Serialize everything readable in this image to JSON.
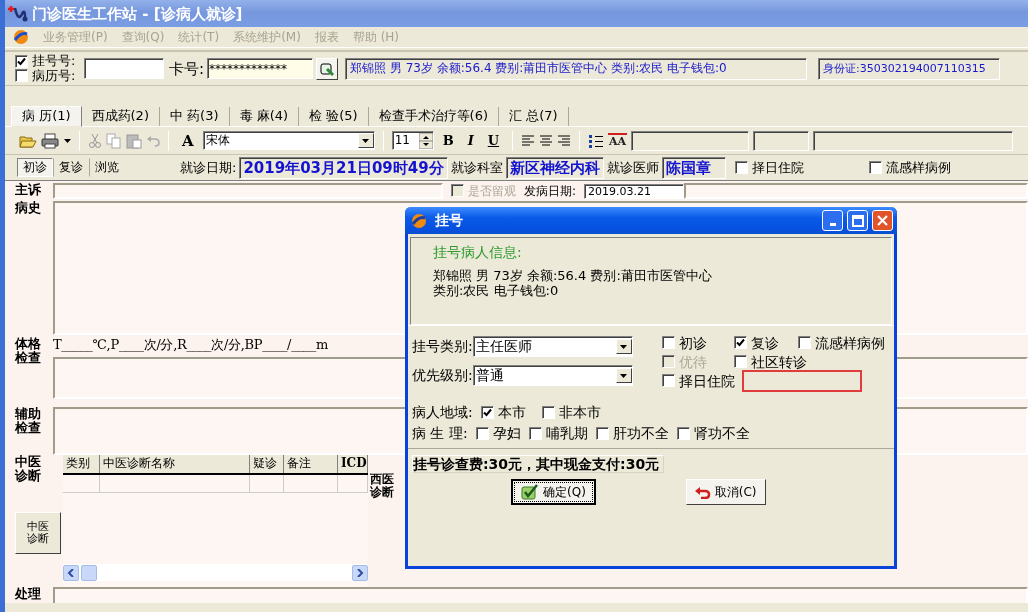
{
  "window": {
    "title": "门诊医生工作站 - [诊病人就诊]"
  },
  "menu": [
    {
      "label": "业务管理(P)",
      "disabled": true
    },
    {
      "label": "查询(Q)",
      "disabled": true
    },
    {
      "label": "统计(T)",
      "disabled": true
    },
    {
      "label": "系统维护(M)",
      "disabled": true
    },
    {
      "label": "报表",
      "disabled": true
    },
    {
      "label": "帮助 (H)",
      "disabled": true
    }
  ],
  "patient_bar": {
    "lookups": [
      {
        "label": "挂号号:",
        "checked": true
      },
      {
        "label": "病历号:",
        "checked": false
      }
    ],
    "card_label": "卡号:",
    "card_value": "*************",
    "info": "郑锦照 男 73岁 余额:56.4 费别:莆田市医管中心 类别:农民 电子钱包:0",
    "id_card": "身份证:350302194007110315"
  },
  "tabs": [
    {
      "label": "病 历(1)",
      "selected": true
    },
    {
      "label": "西成药(2)",
      "selected": false
    },
    {
      "label": "中 药(3)",
      "selected": false
    },
    {
      "label": "毒 麻(4)",
      "selected": false
    },
    {
      "label": "检 验(5)",
      "selected": false
    },
    {
      "label": "检查手术治疗等(6)",
      "selected": false
    },
    {
      "label": "汇 总(7)",
      "selected": false
    }
  ],
  "toolbar": {
    "font_letter": "A",
    "font": "宋体",
    "size": "11",
    "format": [
      "B",
      "I",
      "U"
    ],
    "case_letters": "AA"
  },
  "visit": {
    "modes": [
      {
        "label": "初诊",
        "selected": true
      },
      {
        "label": "复诊",
        "selected": false
      },
      {
        "label": "浏览",
        "selected": false
      }
    ],
    "date_label": "就诊日期:",
    "date": "2019年03月21日09时49分",
    "dept_label": "就诊科室",
    "dept": "新区神经内科",
    "doctor_label": "就诊医师",
    "doctor": "陈国章",
    "options": [
      {
        "label": "择日住院",
        "checked": false
      },
      {
        "label": "流感样病例",
        "checked": false
      }
    ]
  },
  "record": {
    "complaint_label": "主诉",
    "observe": {
      "label": "是否留观",
      "checked": false,
      "disabled": true
    },
    "onset_label": "发病日期:",
    "onset": "2019.03.21",
    "history_label": "病史",
    "exam_label": "体格检查",
    "vitals": "T_____℃,P____次/分,R____次/分,BP____/____m",
    "aux_label": "辅助检查",
    "tcm_label": "中医诊断",
    "tcm_columns": [
      "类别",
      "中医诊断名称",
      "疑诊",
      "备注",
      "ICD"
    ],
    "tcm_button": "中医诊断",
    "western_label": "西医诊断",
    "treatment_label": "处理"
  },
  "dialog": {
    "title": "挂号",
    "info_heading": "挂号病人信息:",
    "info_lines": [
      "郑锦照 男 73岁 余额:56.4 费别:莆田市医管中心",
      "类别:农民 电子钱包:0"
    ],
    "type_label": "挂号类别:",
    "type_value": "主任医师",
    "priority_label": "优先级别:",
    "priority_value": "普通",
    "option_rows": [
      [
        {
          "label": "初诊",
          "checked": false,
          "disabled": false
        },
        {
          "label": "复诊",
          "checked": true,
          "disabled": false
        },
        {
          "label": "流感样病例",
          "checked": false,
          "disabled": false
        }
      ],
      [
        {
          "label": "优待",
          "checked": false,
          "disabled": true
        },
        {
          "label": "社区转诊",
          "checked": false,
          "disabled": false
        }
      ],
      [
        {
          "label": "择日住院",
          "checked": false,
          "disabled": false
        }
      ]
    ],
    "region_label": "病人地域:",
    "regions": [
      {
        "label": "本市",
        "checked": true
      },
      {
        "label": "非本市",
        "checked": false
      }
    ],
    "physio_label": "病 生 理:",
    "physio": [
      {
        "label": "孕妇",
        "checked": false
      },
      {
        "label": "哺乳期",
        "checked": false
      },
      {
        "label": "肝功不全",
        "checked": false
      },
      {
        "label": "肾功不全",
        "checked": false
      }
    ],
    "fee": "挂号诊查费:30元，其中现金支付:30元",
    "ok": "确定(Q)",
    "cancel": "取消(C)"
  }
}
